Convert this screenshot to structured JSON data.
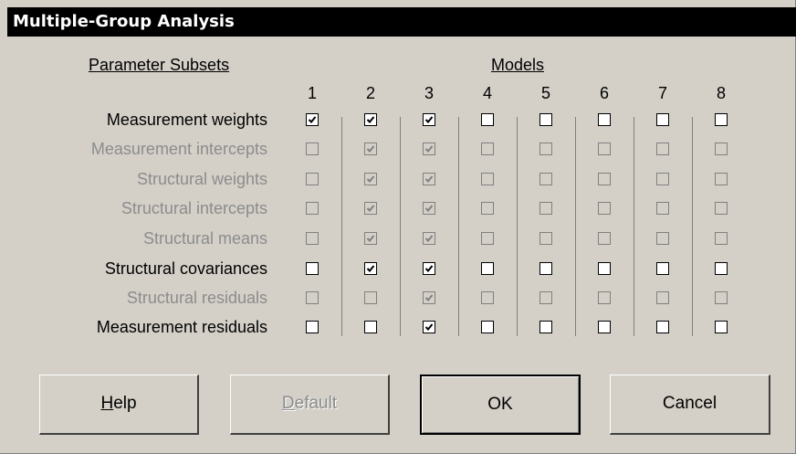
{
  "window": {
    "title": "Multiple-Group Analysis"
  },
  "headers": {
    "parameter_subsets": "Parameter Subsets",
    "models": "Models"
  },
  "columns": [
    "1",
    "2",
    "3",
    "4",
    "5",
    "6",
    "7",
    "8"
  ],
  "rows": [
    {
      "label": "Measurement weights",
      "enabled": true,
      "checks": [
        true,
        true,
        true,
        false,
        false,
        false,
        false,
        false
      ],
      "disabled": [
        false,
        false,
        false,
        false,
        false,
        false,
        false,
        false
      ]
    },
    {
      "label": "Measurement intercepts",
      "enabled": false,
      "checks": [
        false,
        true,
        true,
        false,
        false,
        false,
        false,
        false
      ],
      "disabled": [
        true,
        true,
        true,
        true,
        true,
        true,
        true,
        true
      ]
    },
    {
      "label": "Structural weights",
      "enabled": false,
      "checks": [
        false,
        true,
        true,
        false,
        false,
        false,
        false,
        false
      ],
      "disabled": [
        true,
        true,
        true,
        true,
        true,
        true,
        true,
        true
      ]
    },
    {
      "label": "Structural intercepts",
      "enabled": false,
      "checks": [
        false,
        true,
        true,
        false,
        false,
        false,
        false,
        false
      ],
      "disabled": [
        true,
        true,
        true,
        true,
        true,
        true,
        true,
        true
      ]
    },
    {
      "label": "Structural means",
      "enabled": false,
      "checks": [
        false,
        true,
        true,
        false,
        false,
        false,
        false,
        false
      ],
      "disabled": [
        true,
        true,
        true,
        true,
        true,
        true,
        true,
        true
      ]
    },
    {
      "label": "Structural covariances",
      "enabled": true,
      "checks": [
        false,
        true,
        true,
        false,
        false,
        false,
        false,
        false
      ],
      "disabled": [
        false,
        false,
        false,
        false,
        false,
        false,
        false,
        false
      ]
    },
    {
      "label": "Structural residuals",
      "enabled": false,
      "checks": [
        false,
        false,
        true,
        false,
        false,
        false,
        false,
        false
      ],
      "disabled": [
        true,
        true,
        true,
        true,
        true,
        true,
        true,
        true
      ]
    },
    {
      "label": "Measurement residuals",
      "enabled": true,
      "checks": [
        false,
        false,
        true,
        false,
        false,
        false,
        false,
        false
      ],
      "disabled": [
        false,
        false,
        false,
        false,
        false,
        false,
        false,
        false
      ]
    }
  ],
  "buttons": {
    "help": {
      "mnemonic": "H",
      "rest": "elp"
    },
    "default": {
      "mnemonic": "D",
      "rest": "efault",
      "enabled": false
    },
    "ok": {
      "label": "OK"
    },
    "cancel": {
      "label": "Cancel"
    }
  },
  "colors": {
    "titlebar": "#000000",
    "face": "#d4d0c8",
    "disabled_text": "#8c8c8c"
  }
}
